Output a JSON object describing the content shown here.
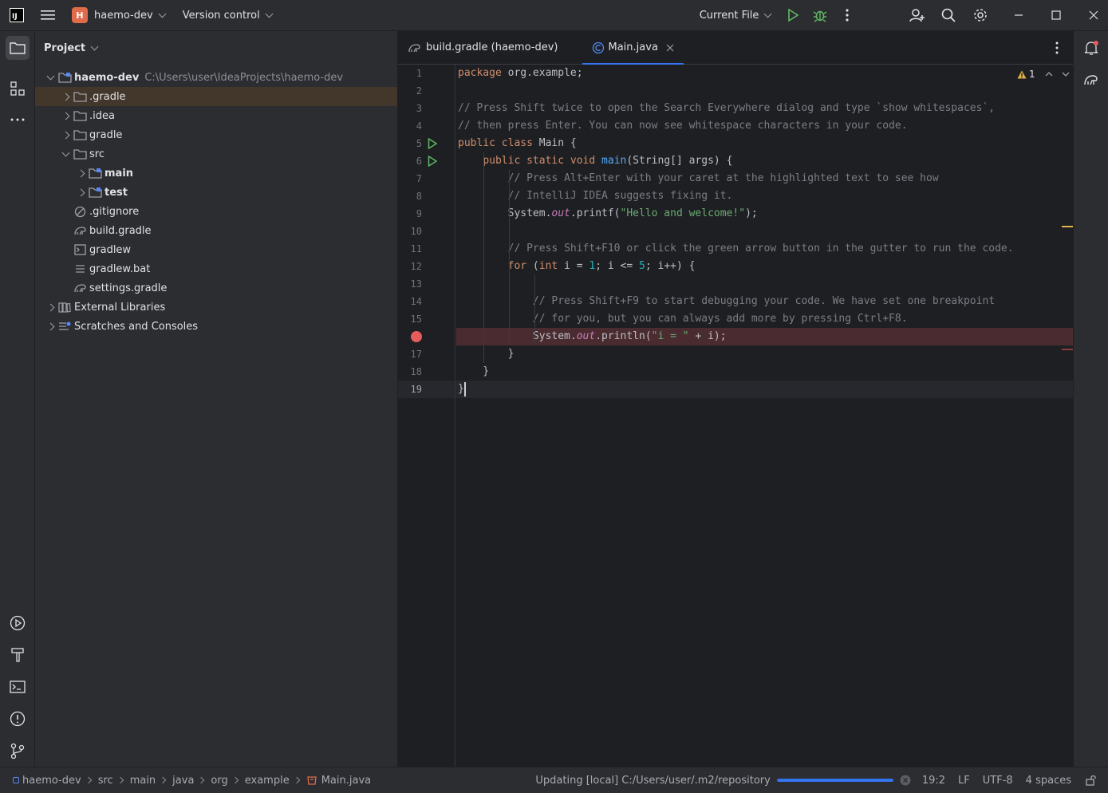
{
  "titlebar": {
    "logo_text": "IJ",
    "project_badge": "H",
    "project_name": "haemo-dev",
    "vcs_label": "Version control",
    "run_config": "Current File"
  },
  "project_panel": {
    "title": "Project",
    "tree": [
      {
        "label": "haemo-dev",
        "hint": "C:\\Users\\user\\IdeaProjects\\haemo-dev",
        "depth": 0,
        "arrow": "down",
        "icon": "module-folder-icon",
        "bold": true
      },
      {
        "label": ".gradle",
        "depth": 1,
        "arrow": "right",
        "icon": "folder-icon",
        "selected": true
      },
      {
        "label": ".idea",
        "depth": 1,
        "arrow": "right",
        "icon": "folder-icon"
      },
      {
        "label": "gradle",
        "depth": 1,
        "arrow": "right",
        "icon": "folder-icon"
      },
      {
        "label": "src",
        "depth": 1,
        "arrow": "down",
        "icon": "folder-icon"
      },
      {
        "label": "main",
        "depth": 2,
        "arrow": "right",
        "icon": "module-folder-icon",
        "bold": true
      },
      {
        "label": "test",
        "depth": 2,
        "arrow": "right",
        "icon": "module-folder-icon",
        "bold": true
      },
      {
        "label": ".gitignore",
        "depth": 1,
        "arrow": "none",
        "icon": "ignore-file-icon"
      },
      {
        "label": "build.gradle",
        "depth": 1,
        "arrow": "none",
        "icon": "gradle-file-icon"
      },
      {
        "label": "gradlew",
        "depth": 1,
        "arrow": "none",
        "icon": "shell-script-icon"
      },
      {
        "label": "gradlew.bat",
        "depth": 1,
        "arrow": "none",
        "icon": "text-file-icon"
      },
      {
        "label": "settings.gradle",
        "depth": 1,
        "arrow": "none",
        "icon": "gradle-file-icon"
      },
      {
        "label": "External Libraries",
        "depth": 0,
        "arrow": "right",
        "icon": "library-icon"
      },
      {
        "label": "Scratches and Consoles",
        "depth": 0,
        "arrow": "right",
        "icon": "scratches-icon"
      }
    ]
  },
  "tabs": [
    {
      "label": "build.gradle (haemo-dev)",
      "icon": "gradle-file-icon",
      "active": false
    },
    {
      "label": "Main.java",
      "icon": "java-class-icon",
      "active": true
    }
  ],
  "editor": {
    "warnings_count": "1",
    "current_line": 19,
    "breakpoint_line": 16,
    "run_gutter_lines": [
      5,
      6
    ],
    "lines": [
      "package org.example;",
      "",
      "// Press Shift twice to open the Search Everywhere dialog and type `show whitespaces`,",
      "// then press Enter. You can now see whitespace characters in your code.",
      "public class Main {",
      "    public static void main(String[] args) {",
      "        // Press Alt+Enter with your caret at the highlighted text to see how",
      "        // IntelliJ IDEA suggests fixing it.",
      "        System.out.printf(\"Hello and welcome!\");",
      "",
      "        // Press Shift+F10 or click the green arrow button in the gutter to run the code.",
      "        for (int i = 1; i <= 5; i++) {",
      "",
      "            // Press Shift+F9 to start debugging your code. We have set one breakpoint",
      "            // for you, but you can always add more by pressing Ctrl+F8.",
      "            System.out.println(\"i = \" + i);",
      "        }",
      "    }",
      "}"
    ]
  },
  "statusbar": {
    "breadcrumbs": [
      "haemo-dev",
      "src",
      "main",
      "java",
      "org",
      "example",
      "Main.java"
    ],
    "task_text": "Updating [local] C:/Users/user/.m2/repository",
    "progress": 1.0,
    "caret_position": "19:2",
    "line_separator": "LF",
    "encoding": "UTF-8",
    "indent": "4 spaces"
  },
  "colors": {
    "accent": "#3574f0",
    "run_green": "#5fb865",
    "breakpoint_red": "#e55c5c",
    "warning_yellow": "#e0b248"
  }
}
